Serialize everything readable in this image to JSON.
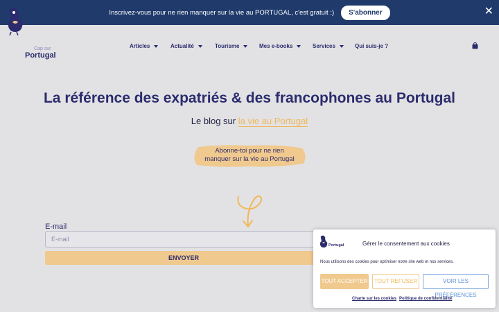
{
  "banner": {
    "text": "Inscrivez-vous pour ne rien manquer sur la vie au PORTUGAL, c'est gratuit :)",
    "subscribe_label": "S'abonner",
    "close_icon": "✕"
  },
  "header": {
    "logo_small": "Cap sur",
    "logo_big": "Portugal",
    "nav": [
      {
        "label": "Articles"
      },
      {
        "label": "Actualité"
      },
      {
        "label": "Tourisme"
      },
      {
        "label": "Mes e-books"
      },
      {
        "label": "Services"
      },
      {
        "label": "Qui suis-je ?"
      }
    ]
  },
  "hero": {
    "title": "La référence des expatriés & des francophones au Portugal",
    "subtitle_prefix": "Le blog sur ",
    "subtitle_highlight": "la vie au Portugal",
    "cta_line1": "Abonne-toi pour ne rien",
    "cta_line2": "manquer sur la vie au Portugal"
  },
  "form": {
    "email_label": "E-mail",
    "email_placeholder": "E-mail",
    "send_label": "ENVOYER"
  },
  "cookie": {
    "logo_text": "Portugal",
    "title": "Gérer le consentement aux cookies",
    "description": "Nous utilisons des cookies pour optimiser notre site web et nos services.",
    "accept_label": "TOUT ACCEPTER",
    "refuse_label": "TOUT REFUSER",
    "prefs_label": "VOIR LES PRÉFÉRENCES",
    "charter_link": "Charte sur les cookies",
    "privacy_link": "Politique de confidentialité"
  },
  "colors": {
    "banner_bg": "#1f3a6b",
    "brand_navy": "#2b2b6e",
    "accent_gold": "#f0c98e",
    "page_bg": "#e2e2e4"
  }
}
